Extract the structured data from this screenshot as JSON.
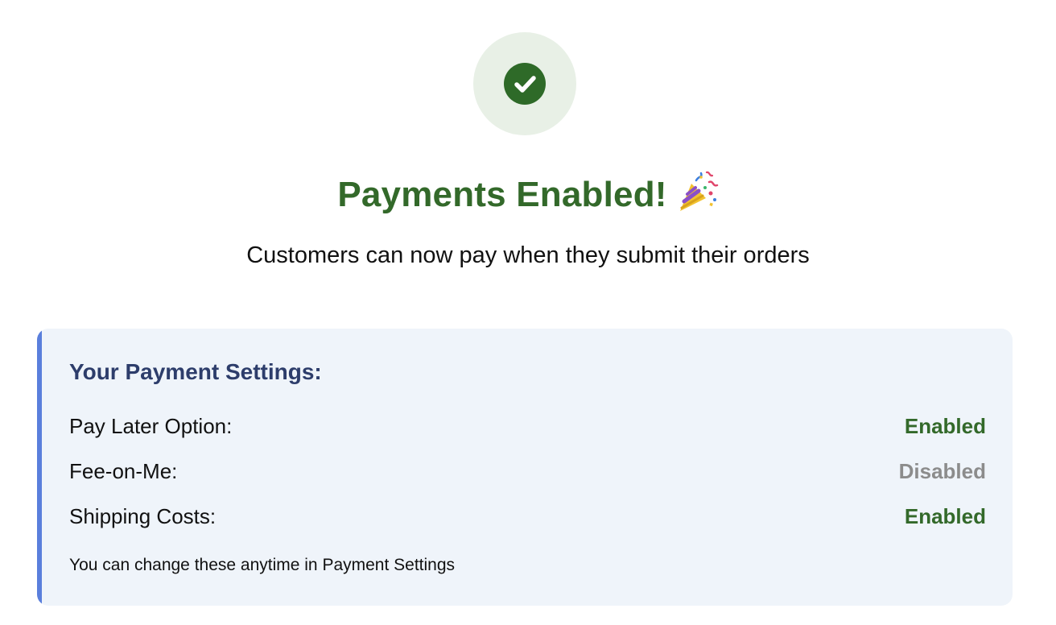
{
  "success": {
    "icon": "check-circle-icon",
    "title": "Payments Enabled!",
    "title_icon": "party-popper-icon",
    "subtitle": "Customers can now pay when they submit their orders"
  },
  "settings_card": {
    "heading": "Your Payment Settings:",
    "rows": [
      {
        "label": "Pay Later Option:",
        "value": "Enabled",
        "status": "enabled"
      },
      {
        "label": "Fee-on-Me:",
        "value": "Disabled",
        "status": "disabled"
      },
      {
        "label": "Shipping Costs:",
        "value": "Enabled",
        "status": "enabled"
      }
    ],
    "note": "You can change these anytime in Payment Settings"
  },
  "colors": {
    "success_green": "#33692a",
    "disabled_gray": "#8c8c8c",
    "card_background": "#eff4fa",
    "card_accent": "#5a7fdc",
    "heading_navy": "#2d3d6b"
  }
}
